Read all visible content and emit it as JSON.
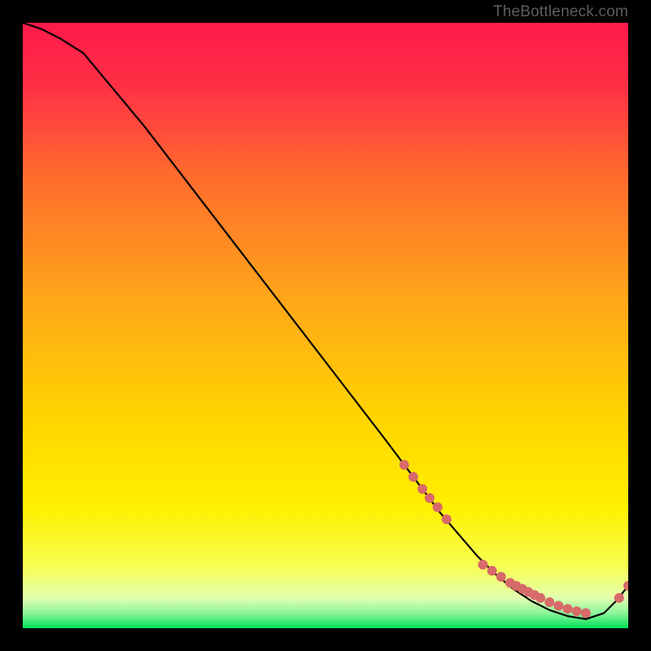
{
  "watermark": "TheBottleneck.com",
  "chart_data": {
    "type": "line",
    "title": "",
    "xlabel": "",
    "ylabel": "",
    "xlim": [
      0,
      100
    ],
    "ylim": [
      0,
      100
    ],
    "grid": false,
    "legend": false,
    "background_colors": {
      "top": "#ff1a4b",
      "mid": "#ffd400",
      "green_band": "#00e05a",
      "bottom_band_top": 95,
      "green_band_top": 97.5
    },
    "series": [
      {
        "name": "bottleneck-curve",
        "color": "#000000",
        "x": [
          0,
          3,
          6,
          10,
          15,
          20,
          25,
          30,
          35,
          40,
          45,
          50,
          55,
          60,
          63,
          66,
          69,
          72,
          75,
          78,
          81,
          84,
          87,
          90,
          93,
          96,
          98,
          100
        ],
        "y": [
          100,
          99,
          97.5,
          95,
          89,
          83,
          76.5,
          70,
          63.5,
          57,
          50.5,
          44,
          37.5,
          31,
          27,
          23,
          19,
          15.5,
          12,
          9,
          6.5,
          4.5,
          3,
          2,
          1.5,
          2.5,
          4.5,
          7
        ]
      }
    ],
    "markers": [
      {
        "name": "scatter-upper",
        "color": "#d86a6a",
        "r": 6,
        "x": [
          63,
          64.5,
          66,
          67.2,
          68.5,
          70
        ],
        "y": [
          27,
          25,
          23,
          21.5,
          20,
          18
        ]
      },
      {
        "name": "scatter-lower",
        "color": "#d86a6a",
        "r": 6,
        "x": [
          76,
          77.5,
          79,
          80.5,
          81.5,
          82.5,
          83.5,
          84.5,
          85.5,
          87,
          88.5,
          90,
          91.5,
          93
        ],
        "y": [
          10.5,
          9.5,
          8.5,
          7.5,
          7,
          6.5,
          6,
          5.5,
          5,
          4.3,
          3.7,
          3.2,
          2.8,
          2.5
        ]
      },
      {
        "name": "scatter-tail",
        "color": "#d86a6a",
        "r": 6,
        "x": [
          98.5,
          100
        ],
        "y": [
          5,
          7
        ]
      }
    ]
  }
}
